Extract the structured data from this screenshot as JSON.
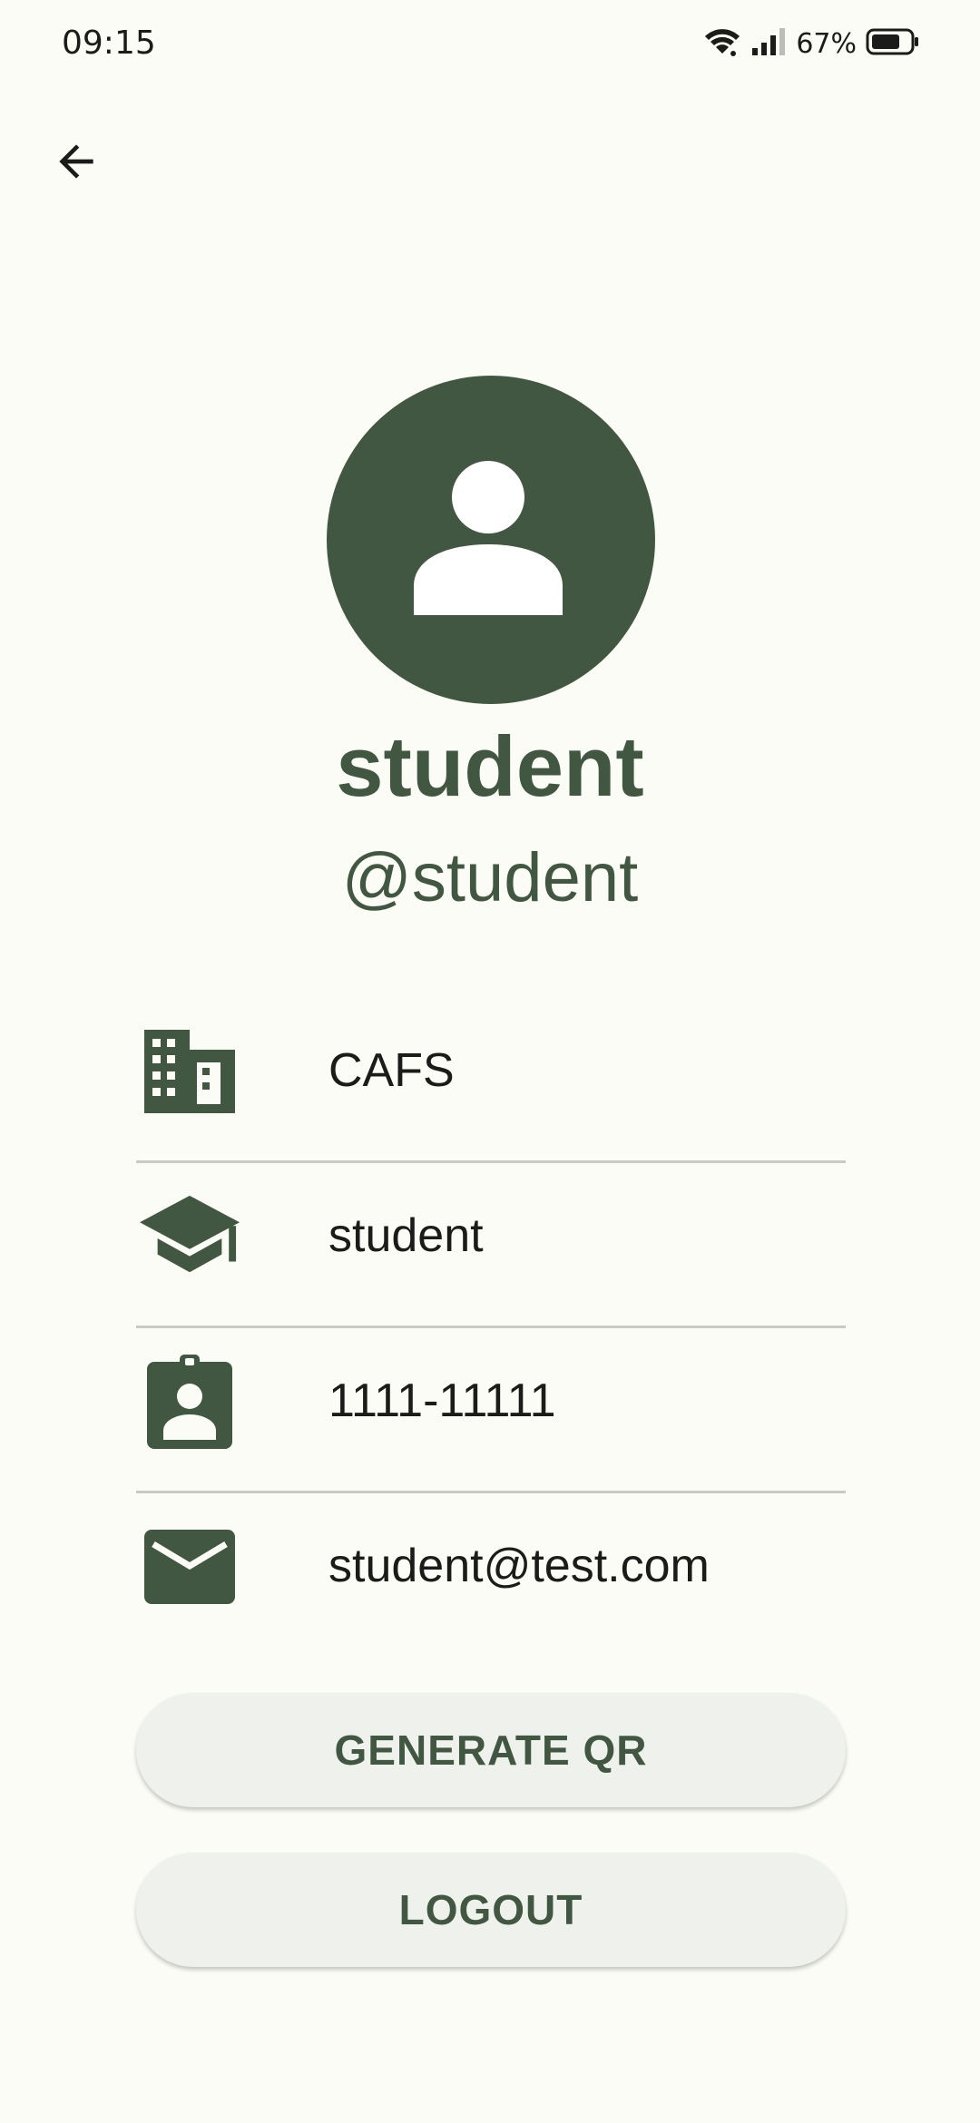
{
  "status_bar": {
    "time": "09:15",
    "battery": "67%"
  },
  "profile": {
    "name": "student",
    "handle": "@student"
  },
  "info": {
    "department": "CAFS",
    "role": "student",
    "id_number": "1111-11111",
    "email": "student@test.com"
  },
  "actions": {
    "generate_qr": "GENERATE QR",
    "logout": "LOGOUT"
  },
  "icons": {
    "back": "arrow-back-icon",
    "avatar": "person-icon",
    "department": "building-icon",
    "role": "graduation-cap-icon",
    "id": "badge-icon",
    "email": "mail-icon"
  },
  "colors": {
    "accent": "#425742",
    "background": "#fcfcf6",
    "button_bg": "#eff2ec"
  }
}
